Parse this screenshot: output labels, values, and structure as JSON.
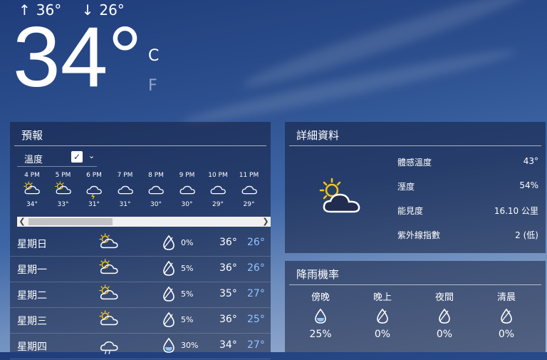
{
  "current": {
    "high_arrow": "↑",
    "high": "36°",
    "low_arrow": "↓",
    "low": "26°",
    "temp": "34°",
    "unit_c": "C",
    "unit_f": "F"
  },
  "forecast": {
    "title": "預報",
    "selector_label": "溫度",
    "selector_check": "✓",
    "hourly": [
      {
        "time": "4 PM",
        "temp": "34°",
        "icon": "partly-sunny-icon"
      },
      {
        "time": "5 PM",
        "temp": "33°",
        "icon": "partly-sunny-icon"
      },
      {
        "time": "6 PM",
        "temp": "31°",
        "icon": "thunder-cloud-icon"
      },
      {
        "time": "7 PM",
        "temp": "31°",
        "icon": "cloud-icon"
      },
      {
        "time": "8 PM",
        "temp": "30°",
        "icon": "cloud-icon"
      },
      {
        "time": "9 PM",
        "temp": "30°",
        "icon": "cloud-icon"
      },
      {
        "time": "10 PM",
        "temp": "29°",
        "icon": "cloud-icon"
      },
      {
        "time": "11 PM",
        "temp": "29°",
        "icon": "cloud-icon"
      }
    ],
    "daily": [
      {
        "day": "星期日",
        "precip": "0%",
        "high": "36°",
        "low": "26°",
        "icon": "partly-sunny-icon",
        "drop": "drop-empty-icon"
      },
      {
        "day": "星期一",
        "precip": "5%",
        "high": "36°",
        "low": "26°",
        "icon": "partly-sunny-icon",
        "drop": "drop-empty-icon"
      },
      {
        "day": "星期二",
        "precip": "5%",
        "high": "35°",
        "low": "27°",
        "icon": "sun-cloud-icon",
        "drop": "drop-empty-icon"
      },
      {
        "day": "星期三",
        "precip": "5%",
        "high": "36°",
        "low": "25°",
        "icon": "partly-sunny-icon",
        "drop": "drop-empty-icon"
      },
      {
        "day": "星期四",
        "precip": "30%",
        "high": "34°",
        "low": "27°",
        "icon": "rain-cloud-icon",
        "drop": "drop-filled-icon"
      }
    ]
  },
  "details": {
    "title": "詳細資料",
    "feels_like_label": "體感溫度",
    "feels_like": "43°",
    "humidity_label": "溼度",
    "humidity": "54%",
    "visibility_label": "能見度",
    "visibility": "16.10 公里",
    "uv_label": "紫外線指數",
    "uv": "2 (低)"
  },
  "rain": {
    "title": "降雨機率",
    "periods": [
      {
        "label": "傍晚",
        "value": "25%"
      },
      {
        "label": "晚上",
        "value": "0%"
      },
      {
        "label": "夜間",
        "value": "0%"
      },
      {
        "label": "清晨",
        "value": "0%"
      }
    ]
  },
  "colors": {
    "low_temp": "#8fc4ff",
    "panel_bg": "rgba(20,30,60,0.55)",
    "sun": "#f5c518"
  }
}
